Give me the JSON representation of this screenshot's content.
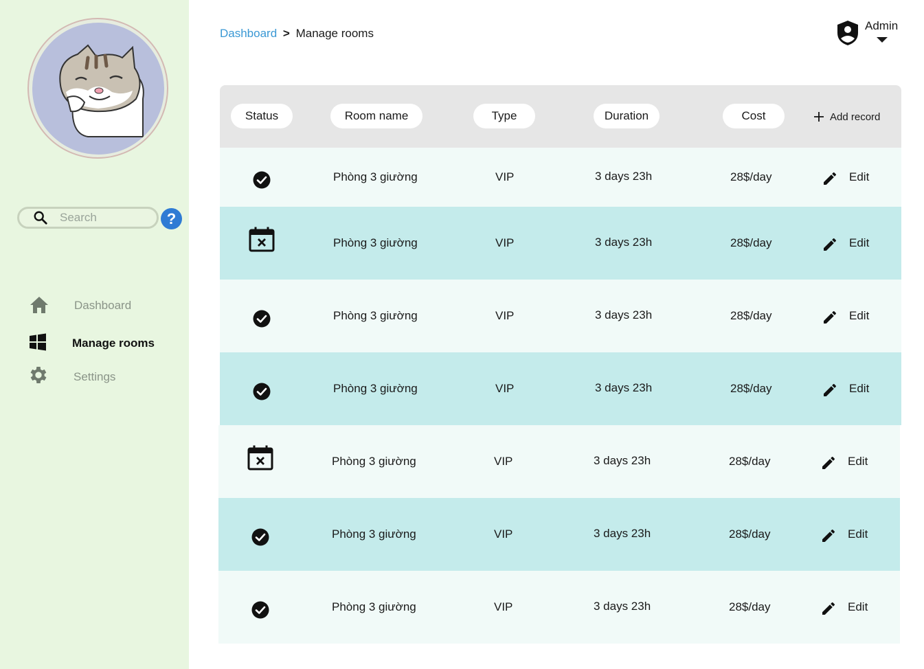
{
  "sidebar": {
    "search_placeholder": "Search",
    "help_label": "?",
    "nav": [
      {
        "label": "Dashboard",
        "icon": "home-icon",
        "active": false
      },
      {
        "label": "Manage rooms",
        "icon": "windows-grid-icon",
        "active": true
      },
      {
        "label": "Settings",
        "icon": "gear-icon",
        "active": false
      }
    ]
  },
  "breadcrumb": {
    "parent": "Dashboard",
    "separator": ">",
    "current": "Manage rooms"
  },
  "user": {
    "role_label": "Admin",
    "icon": "shield-user-icon"
  },
  "table": {
    "columns": [
      "Status",
      "Room name",
      "Type",
      "Duration",
      "Cost"
    ],
    "add_record_label": "Add record",
    "edit_label": "Edit",
    "rows": [
      {
        "status": "available",
        "status_icon": "check-circle-icon",
        "room_name": "Phòng 3 giường",
        "type": "VIP",
        "duration": "3 days 23h",
        "cost": "28$/day"
      },
      {
        "status": "booked",
        "status_icon": "calendar-x-icon",
        "room_name": "Phòng 3 giường",
        "type": "VIP",
        "duration": "3 days 23h",
        "cost": "28$/day"
      },
      {
        "status": "available",
        "status_icon": "check-circle-icon",
        "room_name": "Phòng 3 giường",
        "type": "VIP",
        "duration": "3 days 23h",
        "cost": "28$/day"
      },
      {
        "status": "available",
        "status_icon": "check-circle-icon",
        "room_name": "Phòng 3 giường",
        "type": "VIP",
        "duration": "3 days 23h",
        "cost": "28$/day"
      },
      {
        "status": "booked",
        "status_icon": "calendar-x-icon",
        "room_name": "Phòng 3 giường",
        "type": "VIP",
        "duration": "3 days 23h",
        "cost": "28$/day"
      },
      {
        "status": "available",
        "status_icon": "check-circle-icon",
        "room_name": "Phòng 3 giường",
        "type": "VIP",
        "duration": "3 days 23h",
        "cost": "28$/day"
      },
      {
        "status": "available",
        "status_icon": "check-circle-icon",
        "room_name": "Phòng 3 giường",
        "type": "VIP",
        "duration": "3 days 23h",
        "cost": "28$/day"
      }
    ]
  },
  "colors": {
    "sidebar_bg": "#e8f6e0",
    "row_light": "#f1faf8",
    "row_teal": "#c4ebeb",
    "header_bg": "#e6e6e6",
    "link": "#3a98d4",
    "help": "#2f7bd4",
    "nav_inactive": "#8a9488"
  }
}
